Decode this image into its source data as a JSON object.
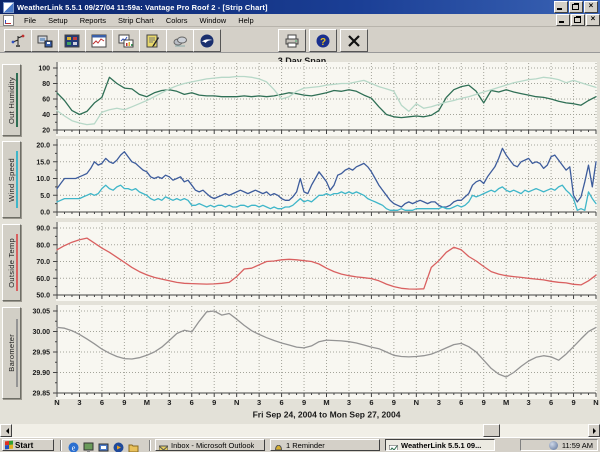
{
  "title_bar": {
    "title": "WeatherLink 5.5.1  09/27/04  11:59a: Vantage Pro Roof 2 - [Strip Chart]",
    "controls": [
      "minimize",
      "restore",
      "close"
    ]
  },
  "menu_bar": {
    "items": [
      "File",
      "Setup",
      "Reports",
      "Strip Chart",
      "Colors",
      "Window",
      "Help"
    ],
    "controls": [
      "minimize",
      "restore",
      "close"
    ]
  },
  "toolbar": {
    "left_buttons": [
      "bulletin",
      "download",
      "summary",
      "strip-chart",
      "plot",
      "notes",
      "weather-cloud",
      "noaa-logo"
    ],
    "right_buttons": [
      "print",
      "help",
      "close"
    ]
  },
  "chart_data": {
    "type": "line",
    "title": "3 Day Span",
    "x_axis": {
      "title": "Fri Sep 24, 2004  to  Mon Sep 27, 2004",
      "hours_total": 72,
      "major_tick_hours": 3,
      "minor_tick_hours": 1,
      "tick_labels": [
        "N",
        "3",
        "6",
        "9",
        "M",
        "3",
        "6",
        "9",
        "N",
        "3",
        "6",
        "9",
        "M",
        "3",
        "6",
        "9",
        "N",
        "3",
        "6",
        "9",
        "M",
        "3",
        "6",
        "9",
        "N"
      ]
    },
    "panels": [
      {
        "label": "Out Humidity",
        "label_color": "#2f6f55",
        "ymin": 20,
        "ymax": 100,
        "yticks": [
          100,
          80,
          60,
          40,
          20
        ],
        "ytick_labels": [
          "100",
          "80",
          "60",
          "40",
          "20"
        ],
        "series": [
          {
            "name": "out-humidity",
            "color": "#2f6f55",
            "values": [
              68,
              58,
              45,
              40,
              44,
              55,
              62,
              88,
              80,
              74,
              73,
              66,
              63,
              68,
              71,
              72,
              70,
              66,
              68,
              65,
              64,
              64,
              63,
              63,
              63,
              64,
              63,
              64,
              63,
              64,
              66,
              68,
              67,
              65,
              64,
              66,
              68,
              71,
              70,
              72,
              70,
              65,
              61,
              50,
              40,
              37,
              36,
              37,
              38,
              37,
              39,
              45,
              62,
              72,
              76,
              78,
              70,
              55,
              71,
              69,
              72,
              69,
              67,
              65,
              63,
              62,
              60,
              57,
              55,
              54,
              52,
              58,
              63
            ]
          },
          {
            "name": "inside-humidity",
            "color": "#b7d8c8",
            "values": [
              45,
              38,
              32,
              29,
              27,
              28,
              43,
              46,
              48,
              46,
              50,
              54,
              58,
              63,
              68,
              73,
              77,
              80,
              82,
              84,
              86,
              87,
              88,
              88,
              89,
              89,
              88,
              86,
              82,
              72,
              60,
              63,
              70,
              74,
              75,
              76,
              78,
              79,
              80,
              80,
              82,
              84,
              80,
              76,
              73,
              70,
              52,
              44,
              54,
              48,
              50,
              53,
              56,
              58,
              61,
              63,
              66,
              69,
              72,
              75,
              78,
              81,
              83,
              85,
              86,
              88,
              87,
              85,
              81,
              84,
              81,
              78,
              75
            ]
          }
        ]
      },
      {
        "label": "Wind Speed",
        "label_color": "#3fb6c9",
        "ymin": 0,
        "ymax": 20,
        "yticks": [
          20,
          15,
          10,
          5,
          0
        ],
        "ytick_labels": [
          "20.0",
          "15.0",
          "10.0",
          "5.0",
          "0.0"
        ],
        "series": [
          {
            "name": "wind-high",
            "color": "#3d5c9c",
            "values": [
              7,
              8.5,
              10,
              10,
              10,
              10,
              10.5,
              11,
              11.5,
              13,
              15,
              14,
              14.5,
              16,
              15,
              14.5,
              15.5,
              17,
              18,
              16.5,
              15,
              14.5,
              13.5,
              12.5,
              12,
              10.5,
              10,
              10.5,
              10,
              11,
              10.5,
              9.5,
              10,
              10.5,
              9,
              9.5,
              8,
              6.5,
              6,
              6.5,
              5.5,
              4.5,
              4,
              4.5,
              5,
              5.5,
              5,
              5.5,
              6,
              6.5,
              6,
              5.5,
              6,
              6.5,
              6,
              5.5,
              6,
              5,
              5.5,
              5,
              4,
              3.5,
              3.5,
              4.5,
              6,
              10,
              6,
              5.5,
              8,
              10,
              12,
              10.5,
              9,
              6.5,
              8,
              11,
              11.5,
              12.5,
              13,
              12.5,
              13.5,
              14,
              14.5,
              13.5,
              12,
              10,
              8,
              6.5,
              5,
              3.5,
              2.5,
              2,
              1.5,
              2.5,
              3,
              2.5,
              3,
              3.5,
              3,
              2.5,
              3,
              3,
              2,
              1.5,
              1.5,
              2,
              3,
              3.5,
              3.5,
              4.5,
              5.5,
              8,
              9,
              9.5,
              8.5,
              10.5,
              12,
              13.5,
              16,
              19,
              17,
              15.5,
              14,
              13.5,
              15,
              15.5,
              16,
              14.5,
              15,
              14.5,
              13,
              14,
              16.5,
              17,
              15.5,
              14,
              12.5,
              13.5,
              5,
              3,
              4.5,
              9,
              14,
              7.5,
              15
            ]
          },
          {
            "name": "wind-avg",
            "color": "#3fb6c9",
            "values": [
              3,
              3.5,
              4,
              4,
              4,
              4,
              4,
              4.5,
              5,
              5.5,
              5,
              5.5,
              7,
              8,
              7,
              6.5,
              7.5,
              8,
              7,
              7,
              6.5,
              7,
              6,
              5.5,
              5,
              4,
              3.5,
              4,
              3.5,
              4.5,
              4,
              3.5,
              4,
              3.5,
              4,
              3.5,
              2,
              2,
              2.5,
              2,
              1.5,
              2,
              1.5,
              2,
              2,
              1.5,
              2,
              1.5,
              1.5,
              2,
              2,
              1.5,
              2,
              2,
              1.5,
              2,
              1.5,
              1,
              1.5,
              1,
              1,
              1.5,
              1.5,
              2,
              3,
              4,
              3,
              3.5,
              3,
              4,
              5,
              5,
              5.5,
              5,
              5.5,
              5.5,
              6,
              5.5,
              6,
              5.5,
              6,
              5.5,
              5,
              4,
              3.5,
              3,
              2.5,
              2,
              1,
              0.5,
              0.5,
              0.5,
              1,
              0.5,
              0.5,
              0.5,
              1,
              1,
              1,
              1,
              1,
              1,
              1,
              1.5,
              1,
              1,
              1.5,
              2,
              1.5,
              2,
              3,
              5,
              4.5,
              5,
              5.5,
              6,
              6.5,
              6,
              7,
              7.5,
              6.5,
              6,
              6.5,
              6,
              5.5,
              6.5,
              6,
              6.5,
              7,
              6.5,
              6,
              6.5,
              7,
              6.5,
              7.5,
              8,
              6.5,
              5.5,
              4,
              0.5,
              1,
              0.5,
              6,
              4,
              2.5
            ]
          }
        ]
      },
      {
        "label": "Outside Temp",
        "label_color": "#d96060",
        "ymin": 50,
        "ymax": 90,
        "yticks": [
          90,
          80,
          70,
          60,
          50
        ],
        "ytick_labels": [
          "90.0",
          "80.0",
          "70.0",
          "60.0",
          "50.0"
        ],
        "series": [
          {
            "name": "outside-temp",
            "color": "#d96060",
            "values": [
              77,
              79.5,
              81.5,
              83,
              84,
              81,
              78,
              75.5,
              72.5,
              69.5,
              66.5,
              64,
              62,
              60.5,
              59.5,
              58.5,
              57.5,
              57,
              56.8,
              56.6,
              56.5,
              56.6,
              57,
              57.5,
              61,
              65.5,
              66,
              68,
              70,
              70.3,
              71,
              71.3,
              71,
              70.5,
              70,
              68.5,
              66,
              64,
              62.5,
              61.5,
              60.8,
              60.3,
              59.8,
              58.5,
              56.5,
              55,
              54,
              53.6,
              53.5,
              53.7,
              66.5,
              70.5,
              75.5,
              78.5,
              77,
              73,
              70.3,
              67,
              64,
              62.5,
              61.5,
              61,
              60.5,
              60,
              59.5,
              59,
              58.2,
              57.6,
              57.2,
              56.4,
              56,
              58.5,
              61.8
            ]
          }
        ]
      },
      {
        "label": "Barometer",
        "label_color": "#949494",
        "ymin": 29.85,
        "ymax": 30.05,
        "yticks": [
          30.05,
          30.0,
          29.95,
          29.9,
          29.85
        ],
        "ytick_labels": [
          "30.05",
          "30.00",
          "29.95",
          "29.90",
          "29.85"
        ],
        "series": [
          {
            "name": "barometer",
            "color": "#949494",
            "values": [
              30.01,
              30.008,
              30.002,
              29.993,
              29.982,
              29.97,
              29.957,
              29.947,
              29.939,
              29.934,
              29.933,
              29.936,
              29.942,
              29.95,
              29.962,
              29.978,
              29.995,
              30.003,
              29.999,
              30.025,
              30.048,
              30.05,
              30.04,
              30.044,
              30.03,
              30.015,
              30.002,
              29.993,
              29.985,
              29.978,
              29.972,
              29.967,
              29.962,
              29.96,
              29.965,
              29.975,
              29.979,
              29.978,
              29.977,
              29.975,
              29.972,
              29.967,
              29.962,
              29.958,
              29.95,
              29.942,
              29.939,
              29.938,
              29.939,
              29.941,
              29.945,
              29.952,
              29.96,
              29.968,
              29.971,
              29.963,
              29.95,
              29.93,
              29.91,
              29.896,
              29.889,
              29.9,
              29.915,
              29.928,
              29.937,
              29.941,
              29.938,
              29.93,
              29.945,
              29.963,
              29.982,
              30.0,
              30.01
            ]
          }
        ]
      }
    ]
  },
  "taskbar": {
    "start_label": "Start",
    "quick_launch": [
      "internet-explorer",
      "show-desktop",
      "channels",
      "media-player",
      "folder"
    ],
    "tasks": [
      {
        "label": "Inbox - Microsoft Outlook",
        "icon": "outlook",
        "active": false
      },
      {
        "label": "1 Reminder",
        "icon": "reminder",
        "active": false
      },
      {
        "label": "WeatherLink 5.5.1  09...",
        "icon": "weatherlink",
        "active": true
      }
    ],
    "tray_time": "11:59 AM"
  }
}
